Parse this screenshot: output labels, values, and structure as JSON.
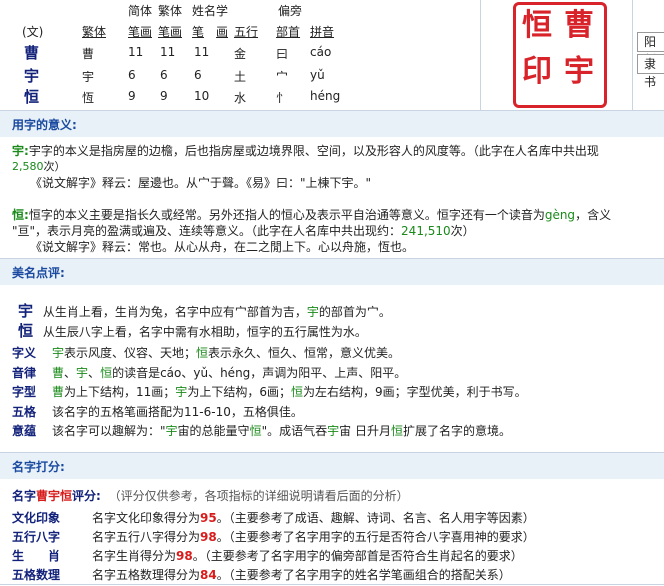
{
  "header": {
    "col_top": {
      "jianti": "简体",
      "fanti": "繁体",
      "xingming": "姓名学",
      "pianpang": "偏旁"
    },
    "col_sub": {
      "wen": "(文)",
      "fanti_char": "繁体",
      "bihua1": "笔画",
      "bihua2": "笔画",
      "bi": "笔",
      "hua": "画",
      "wuxing": "五行",
      "bushou": "部首",
      "pinyin": "拼音"
    },
    "rows": [
      {
        "char": "曹",
        "fanti": "曹",
        "n1": "11",
        "n2": "11",
        "n3": "11",
        "wuxing": "金",
        "bushou": "曰",
        "pinyin": "cáo"
      },
      {
        "char": "宇",
        "fanti": "宇",
        "n1": "6",
        "n2": "6",
        "n3": "6",
        "wuxing": "土",
        "bushou": "宀",
        "pinyin": "yǔ"
      },
      {
        "char": "恒",
        "fanti": "恆",
        "n1": "9",
        "n2": "9",
        "n3": "10",
        "wuxing": "水",
        "bushou": "忄",
        "pinyin": "héng"
      }
    ],
    "seal": {
      "c1": "曹",
      "c2": "宇",
      "c3": "恒",
      "c4": "印"
    },
    "right_box1": "阳刻",
    "right_box2": "隶书"
  },
  "meaning": {
    "title": "用字的意义:",
    "yu_label": "宇:",
    "yu_text": "宇字的本义是指房屋的边檐，后也指房屋或边境界限、空间，以及形容人的风度等。（此字在人名库中共出现",
    "yu_count": "2,580",
    "yu_count_suffix": "次）",
    "yu_shuowen": "《说文解字》释云：屋邊也。从宀于聲。《易》曰：\"上棟下宇。\"",
    "heng_label": "恒:",
    "heng_text": "恒字的本义主要是指长久或经常。另外还指人的恒心及表示平自治通等意义。恒字还有一个读音为",
    "heng_geng": "gèng",
    "heng_text2": "，含义",
    "heng_text3": "\"亘\"，表示月亮的盈满或遍及、连续等意义。（此字在人名库中共出现约：",
    "heng_count": "241,510",
    "heng_count_suffix": "次）",
    "heng_shuowen": "《说文解字》释云：常也。从心从舟，在二之閒上下。心以舟施，恆也。"
  },
  "review": {
    "title": "美名点评:",
    "l1_char": "宇",
    "l1_text_a": "从生肖上看，生肖为兔，名字中应有宀部首为吉，",
    "l1_hl": "宇",
    "l1_text_b": "的部首为宀。",
    "l2_char": "恒",
    "l2_text": "从生辰八字上看，名字中需有水相助，恒字的五行属性为水。",
    "rows": [
      {
        "label": "字义",
        "parts": [
          {
            "t": "宇",
            "c": "grn"
          },
          {
            "t": "表示风度、仪容、天地；",
            "c": ""
          },
          {
            "t": "恒",
            "c": "grn"
          },
          {
            "t": "表示永久、恒久、恒常，意义优美。",
            "c": ""
          }
        ]
      },
      {
        "label": "音律",
        "parts": [
          {
            "t": "曹",
            "c": "grn"
          },
          {
            "t": "、",
            "c": ""
          },
          {
            "t": "宇",
            "c": "grn"
          },
          {
            "t": "、",
            "c": ""
          },
          {
            "t": "恒",
            "c": "grn"
          },
          {
            "t": "的读音是cáo、yǔ、héng，声调为阳平、上声、阳平。",
            "c": ""
          }
        ]
      },
      {
        "label": "字型",
        "parts": [
          {
            "t": "曹",
            "c": "grn"
          },
          {
            "t": "为上下结构，11画；",
            "c": ""
          },
          {
            "t": "宇",
            "c": "grn"
          },
          {
            "t": "为上下结构，6画；",
            "c": ""
          },
          {
            "t": "恒",
            "c": "grn"
          },
          {
            "t": "为左右结构，9画；字型优美，利于书写。",
            "c": ""
          }
        ]
      },
      {
        "label": "五格",
        "parts": [
          {
            "t": "该名字的五格笔画搭配为11-6-10，五格俱佳。",
            "c": ""
          }
        ]
      },
      {
        "label": "意蕴",
        "parts": [
          {
            "t": "该名字可以趣解为：\"",
            "c": ""
          },
          {
            "t": "宇",
            "c": "grn"
          },
          {
            "t": "宙的总能量守",
            "c": ""
          },
          {
            "t": "恒",
            "c": "grn"
          },
          {
            "t": "\"。成语气吞",
            "c": ""
          },
          {
            "t": "宇",
            "c": "grn"
          },
          {
            "t": "宙 日升月",
            "c": ""
          },
          {
            "t": "恒",
            "c": "grn"
          },
          {
            "t": "扩展了名字的意境。",
            "c": ""
          }
        ]
      }
    ]
  },
  "score": {
    "title": "名字打分:",
    "name_prefix": "名字",
    "name": "曹宇恒",
    "name_suffix": "评分:",
    "note": "（评分仅供参考，各项指标的详细说明请看后面的分析）",
    "rows": [
      {
        "label": "文化印象",
        "pre": "名字文化印象得分为",
        "score": "95",
        "post": "。（主要参考了成语、趣解、诗词、名言、名人用字等因素）"
      },
      {
        "label": "五行八字",
        "pre": "名字五行八字得分为",
        "score": "98",
        "post": "。（主要参考了名字用字的五行是否符合八字喜用神的要求）"
      },
      {
        "label": "生　　肖",
        "pre": "名字生肖得分为",
        "score": "98",
        "post": "。（主要参考了名字用字的偏旁部首是否符合生肖起名的要求）"
      },
      {
        "label": "五格数理",
        "pre": "名字五格数理得分为",
        "score": "84",
        "post": "。（主要参考了名字用字的姓名学笔画组合的搭配关系）"
      }
    ]
  }
}
